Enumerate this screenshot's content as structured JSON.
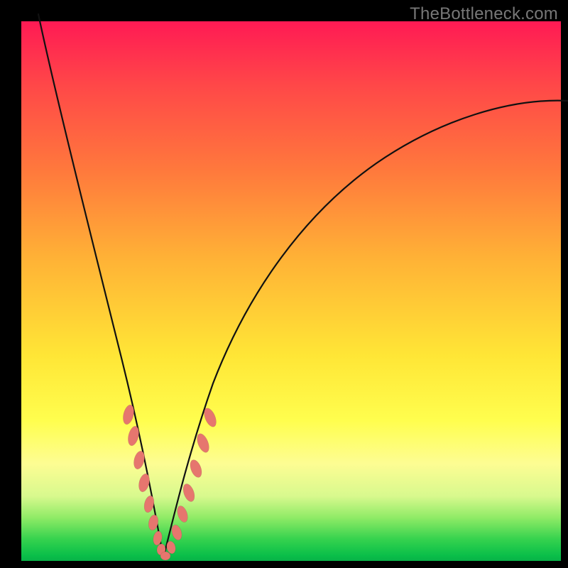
{
  "watermark": "TheBottleneck.com",
  "colors": {
    "frame": "#000000",
    "curve": "#111111",
    "beads": "#e6766e",
    "gradient_top": "#ff1a54",
    "gradient_bottom": "#08b147"
  },
  "chart_data": {
    "type": "line",
    "title": "",
    "xlabel": "",
    "ylabel": "",
    "xlim": [
      0,
      100
    ],
    "ylim": [
      0,
      100
    ],
    "note": "Axes are unlabeled; values estimated from pixel positions as percentage of plot area (0 = left/bottom, 100 = right/top).",
    "series": [
      {
        "name": "left-branch",
        "x": [
          3,
          5,
          8,
          11,
          14,
          16,
          18,
          20,
          22,
          24,
          25,
          26
        ],
        "y": [
          100,
          89,
          75,
          61,
          48,
          38,
          30,
          22,
          14,
          7,
          3,
          0
        ]
      },
      {
        "name": "right-branch",
        "x": [
          26,
          28,
          30,
          33,
          37,
          42,
          48,
          55,
          63,
          72,
          82,
          92,
          100
        ],
        "y": [
          0,
          5,
          12,
          21,
          32,
          43,
          53,
          61,
          68,
          74,
          79,
          83,
          85
        ]
      }
    ],
    "markers": {
      "name": "beads",
      "description": "salmon-colored elongated beads clustered near the curve minimum on both branches",
      "points": [
        {
          "x": 19.5,
          "y": 27
        },
        {
          "x": 20.5,
          "y": 23
        },
        {
          "x": 21.5,
          "y": 18
        },
        {
          "x": 22.5,
          "y": 14
        },
        {
          "x": 23.3,
          "y": 10
        },
        {
          "x": 24.2,
          "y": 6.5
        },
        {
          "x": 25.0,
          "y": 3.5
        },
        {
          "x": 25.8,
          "y": 1.5
        },
        {
          "x": 26.5,
          "y": 0.5
        },
        {
          "x": 27.5,
          "y": 2
        },
        {
          "x": 28.5,
          "y": 5
        },
        {
          "x": 29.5,
          "y": 9
        },
        {
          "x": 30.8,
          "y": 13
        },
        {
          "x": 32.0,
          "y": 18
        },
        {
          "x": 33.2,
          "y": 22
        },
        {
          "x": 34.5,
          "y": 27
        }
      ]
    }
  }
}
